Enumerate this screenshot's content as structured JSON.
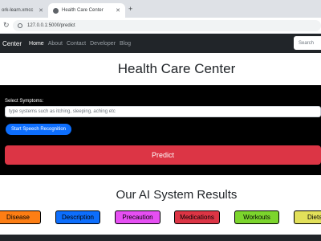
{
  "browser": {
    "tabs": [
      {
        "label": "ork-learn.xmcc"
      },
      {
        "label": "Health Care Center"
      }
    ],
    "url": "127.0.0.1:5000/predict"
  },
  "navbar": {
    "brand": "Center",
    "links": [
      "Home",
      "About",
      "Contact",
      "Developer",
      "Blog"
    ],
    "search_placeholder": "Search"
  },
  "hero": {
    "title": "Health Care Center"
  },
  "form": {
    "label": "Select Symptoms:",
    "placeholder": "type systems such as itching, sleeping, aching etc",
    "speech_button": "Start Speech Recognition",
    "predict_button": "Predict"
  },
  "results": {
    "title": "Our AI System Results",
    "buttons": [
      {
        "label": "Disease",
        "color": "#fd7e14"
      },
      {
        "label": "Description",
        "color": "#0d6efd"
      },
      {
        "label": "Precaution",
        "color": "#e64ff3"
      },
      {
        "label": "Medications",
        "color": "#dc3545"
      },
      {
        "label": "Workouts",
        "color": "#7cd52d"
      },
      {
        "label": "Diets",
        "color": "#e2e05a"
      }
    ]
  },
  "colors": {
    "navbar": "#212529",
    "panel": "#000000",
    "speech_button": "#0d6efd",
    "predict_button": "#dc3545"
  }
}
